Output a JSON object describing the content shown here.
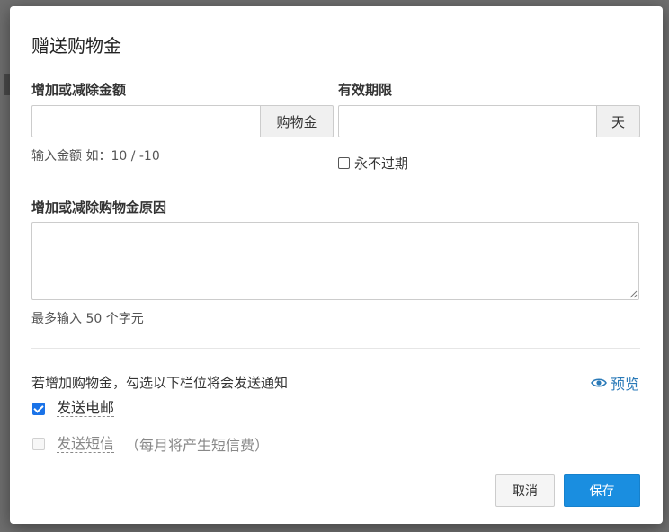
{
  "dialog": {
    "title": "赠送购物金",
    "amount": {
      "label": "增加或减除金额",
      "value": "",
      "addon": "购物金",
      "hint": "输入金额 如：10 / -10"
    },
    "validity": {
      "label": "有效期限",
      "value": "",
      "addon": "天",
      "never_expire_label": "永不过期"
    },
    "reason": {
      "label": "增加或减除购物金原因",
      "value": "",
      "hint": "最多输入 50 个字元"
    },
    "notify": {
      "text": "若增加购物金，勾选以下栏位将会发送通知",
      "preview_label": "预览",
      "email_label": "发送电邮",
      "email_checked": true,
      "sms_label": "发送短信",
      "sms_note": "（每月将产生短信费）",
      "sms_checked": false
    },
    "buttons": {
      "cancel": "取消",
      "save": "保存"
    }
  },
  "colors": {
    "accent": "#1a8ee0",
    "link": "#2a7ab8",
    "checkbox": "#1a73e8"
  }
}
